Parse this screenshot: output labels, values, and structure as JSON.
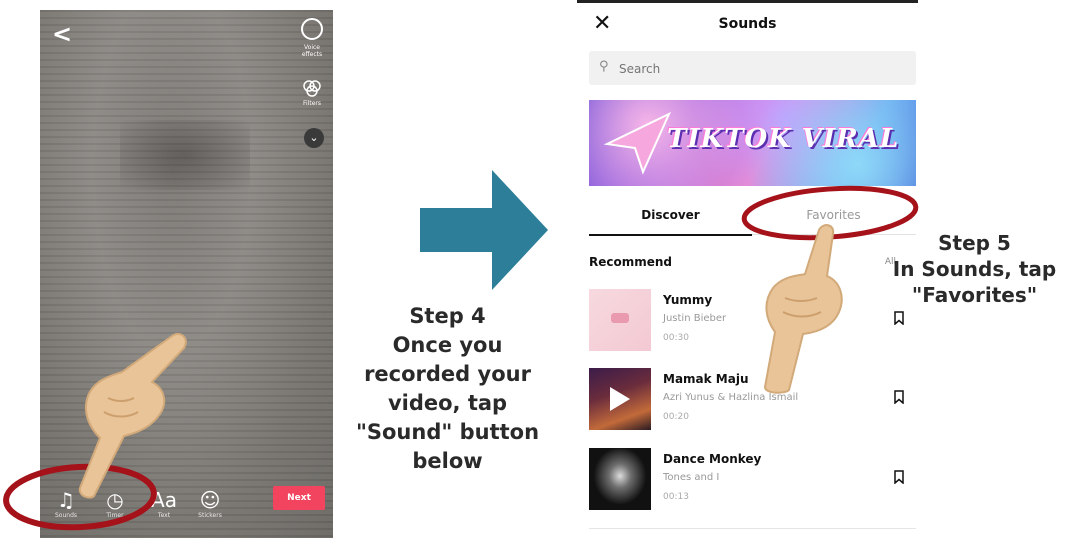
{
  "left_phone": {
    "top_right": {
      "speed_label": "Voice effects",
      "filters_label": "Filters"
    },
    "tools": [
      {
        "name": "sound",
        "glyph": "♫",
        "label": "Sounds"
      },
      {
        "name": "timer",
        "glyph": "◷",
        "label": "Timer"
      },
      {
        "name": "text",
        "glyph": "Aa",
        "label": "Text"
      },
      {
        "name": "stickers",
        "glyph": "☺",
        "label": "Stickers"
      }
    ],
    "next_label": "Next"
  },
  "steps": {
    "step4_title": "Step 4",
    "step4_lines": [
      "Once you",
      "recorded your",
      "video, tap",
      "\"Sound\" button",
      "below"
    ],
    "step5_title": "Step 5",
    "step5_lines": [
      "In Sounds, tap",
      "\"Favorites\""
    ]
  },
  "sounds_sheet": {
    "title": "Sounds",
    "search_placeholder": "Search",
    "banner_text": "TIKTOK VIRAL",
    "tabs": [
      "Discover",
      "Favorites"
    ],
    "active_tab": "Discover",
    "section_title": "Recommend",
    "section_all": "All",
    "tracks": [
      {
        "title": "Yummy",
        "artist": "Justin Bieber",
        "duration": "00:30"
      },
      {
        "title": "Mamak Maju",
        "artist": "Azri Yunus & Hazlina Ismail",
        "duration": "00:20"
      },
      {
        "title": "Dance Monkey",
        "artist": "Tones and I",
        "duration": "00:13"
      }
    ]
  },
  "colors": {
    "next_button": "#f2445e",
    "arrow": "#2d7f99",
    "annotation_circle": "#a5121a",
    "hand_skin": "#e9c498"
  }
}
